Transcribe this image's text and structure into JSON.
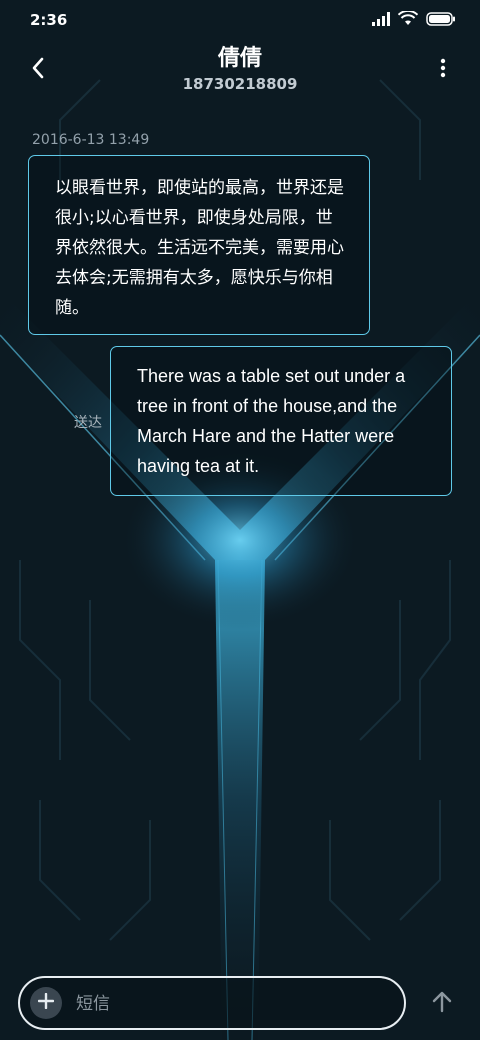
{
  "status_bar": {
    "time": "2:36",
    "icons": [
      "signal-icon",
      "wifi-icon",
      "battery-icon"
    ]
  },
  "header": {
    "contact_name": "倩倩",
    "contact_number": "18730218809",
    "back_icon": "chevron-left-icon",
    "more_icon": "more-vertical-icon"
  },
  "conversation": {
    "timestamp": "2016-6-13 13:49",
    "messages": [
      {
        "direction": "incoming",
        "text": "以眼看世界，即使站的最高，世界还是很小;以心看世界，即使身处局限，世界依然很大。生活远不完美，需要用心去体会;无需拥有太多，愿快乐与你相随。"
      },
      {
        "direction": "outgoing",
        "text": "There was a table set out under a tree in front of the house,and the March Hare and the Hatter were having tea at it.",
        "status": "送达"
      }
    ]
  },
  "compose": {
    "placeholder": "短信",
    "value": "",
    "add_icon": "plus-icon",
    "send_icon": "arrow-up-icon"
  },
  "colors": {
    "background": "#0c1a22",
    "bubble_border": "#5fc9e8",
    "accent_glow": "#3fb6e0",
    "text_primary": "#ffffff",
    "text_secondary": "#93a1ab"
  }
}
